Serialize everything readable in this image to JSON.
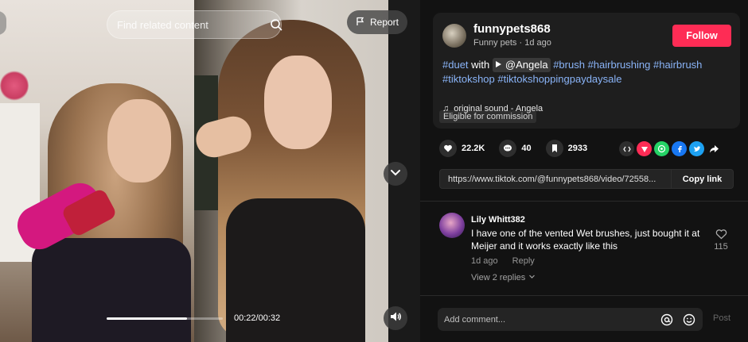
{
  "video": {
    "search_placeholder": "Find related content",
    "report_label": "Report",
    "time": "00:22/00:32",
    "progress": 0.69
  },
  "post": {
    "username": "funnypets868",
    "subtitle": "Funny pets · 1d ago",
    "follow_label": "Follow",
    "description_prefix": "#duet",
    "description_with": " with ",
    "mention": "@Angela",
    "tags": [
      "#brush",
      "#hairbrushing",
      "#hairbrush",
      "#tiktokshop",
      "#tiktokshoppingpaydaysale"
    ],
    "sound": "original sound - Angela",
    "commission": "Eligible for commission"
  },
  "stats": {
    "likes": "22.2K",
    "comments": "40",
    "saves": "2933"
  },
  "share_icons": [
    "embed-icon",
    "send-icon",
    "whatsapp-icon",
    "facebook-icon",
    "twitter-icon",
    "share-arrow-icon"
  ],
  "link": {
    "url": "https://www.tiktok.com/@funnypets868/video/72558...",
    "copy_label": "Copy link"
  },
  "comment": {
    "name": "Lily Whitt382",
    "text": "I have one of the vented Wet brushes, just bought it at Meijer and it works exactly like this",
    "time": "1d ago",
    "reply_label": "Reply",
    "view_replies": "View 2 replies",
    "likes": "115"
  },
  "composer": {
    "placeholder": "Add comment...",
    "post_label": "Post"
  },
  "colors": {
    "accent": "#fe2c55",
    "hashtag": "#8ab4f8",
    "background": "#121212"
  }
}
